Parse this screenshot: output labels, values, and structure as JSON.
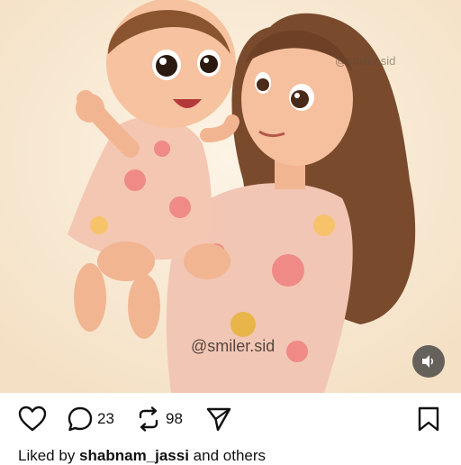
{
  "post": {
    "watermark_top": "@smiler.sid",
    "watermark_bottom": "@smiler.sid",
    "sound_icon": "speaker-icon"
  },
  "actions": {
    "like_icon": "heart-icon",
    "comment_icon": "comment-bubble-icon",
    "comment_count": "23",
    "repost_icon": "repost-icon",
    "repost_count": "98",
    "share_icon": "send-icon",
    "save_icon": "bookmark-icon"
  },
  "likes": {
    "prefix": "Liked by ",
    "user": "shabnam_jassi",
    "suffix": " and others"
  }
}
